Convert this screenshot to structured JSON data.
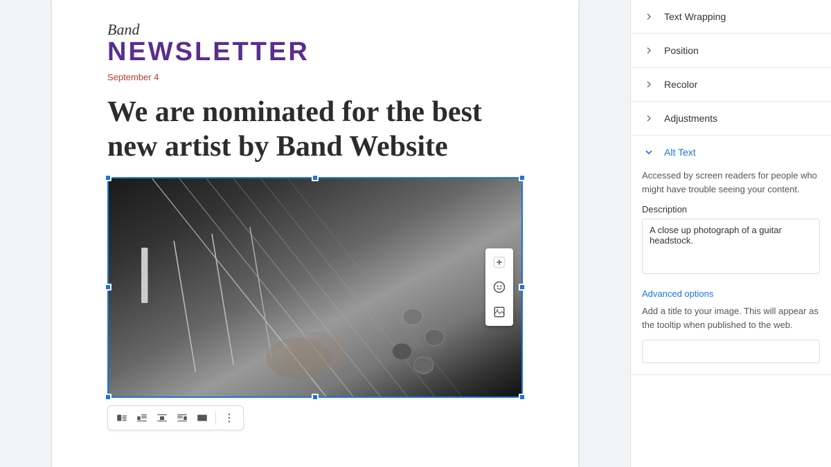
{
  "document": {
    "newsletter_script": "Band",
    "newsletter_title": "NEWSLETTER",
    "date": "September 4",
    "headline": "We are nominated for the best new artist by Band Website"
  },
  "image_toolbar": {
    "add_icon_label": "➕",
    "emoji_icon_label": "🙂",
    "image_icon_label": "🖼"
  },
  "bottom_toolbar": {
    "buttons": [
      {
        "id": "wrap-none",
        "title": "Wrap none",
        "active": false
      },
      {
        "id": "wrap-inline",
        "title": "Wrap inline",
        "active": false
      },
      {
        "id": "wrap-left",
        "title": "Wrap left",
        "active": false
      },
      {
        "id": "wrap-right",
        "title": "Wrap right",
        "active": false
      },
      {
        "id": "wrap-full",
        "title": "Wrap full",
        "active": false
      }
    ],
    "more_label": "⋮"
  },
  "right_panel": {
    "sections": [
      {
        "id": "text-wrapping",
        "label": "Text Wrapping",
        "expanded": false
      },
      {
        "id": "position",
        "label": "Position",
        "expanded": false
      },
      {
        "id": "recolor",
        "label": "Recolor",
        "expanded": false
      },
      {
        "id": "adjustments",
        "label": "Adjustments",
        "expanded": false
      }
    ],
    "alt_text": {
      "title": "Alt Text",
      "description": "Accessed by screen readers for people who might have trouble seeing your content.",
      "description_label": "Description",
      "description_value": "A close up photograph of a guitar headstock.",
      "advanced_options_label": "Advanced options",
      "advanced_options_desc": "Add a title to your image. This will appear as the tooltip when published to the web.",
      "title_input_placeholder": "",
      "title_input_value": ""
    }
  }
}
